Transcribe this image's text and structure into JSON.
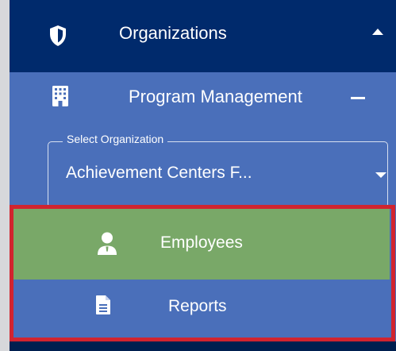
{
  "sidebar": {
    "organizations": {
      "label": "Organizations",
      "icon": "shield-icon",
      "expanded": true
    },
    "program_management": {
      "label": "Program Management",
      "icon": "building-icon"
    },
    "select_organization": {
      "legend": "Select Organization",
      "value": "Achievement Centers F..."
    },
    "items": [
      {
        "label": "Employees",
        "icon": "user-icon",
        "selected": true
      },
      {
        "label": "Reports",
        "icon": "document-icon",
        "selected": false
      }
    ]
  },
  "colors": {
    "header": "#002a6c",
    "submenu": "#4a6fba",
    "selected": "#79a868",
    "highlight": "#d1242f"
  }
}
